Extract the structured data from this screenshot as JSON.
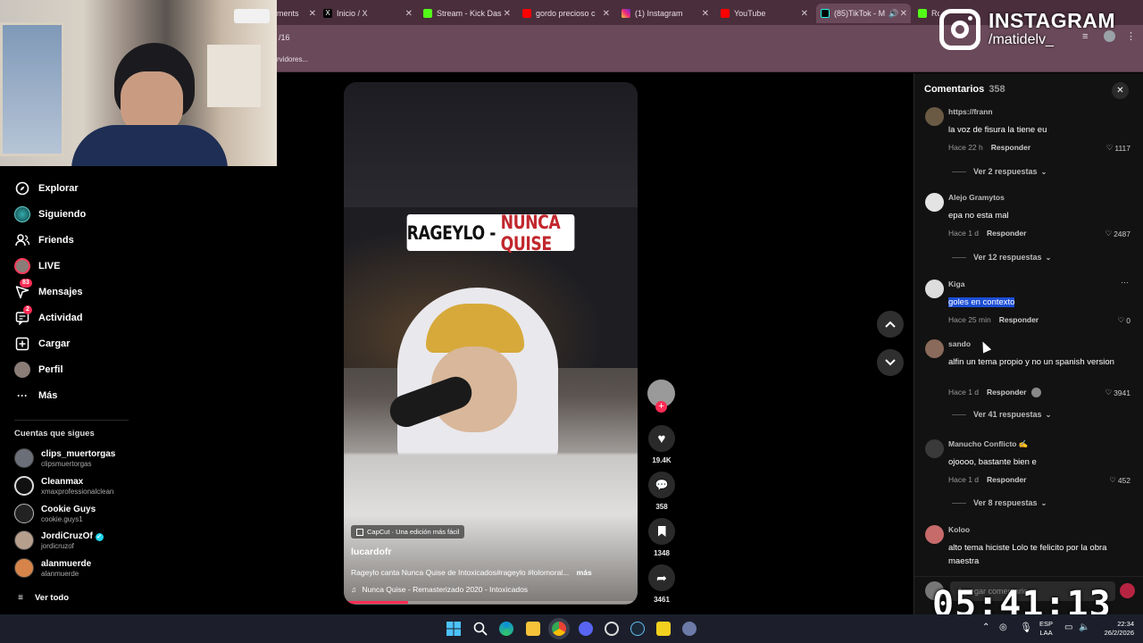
{
  "browser": {
    "tabs": [
      {
        "label": "ments",
        "color": "#2b6fd6"
      },
      {
        "label": "Inicio / X",
        "color": "#000000"
      },
      {
        "label": "Stream - Kick Das",
        "color": "#53fc18"
      },
      {
        "label": "gordo precioso c",
        "color": "#ff0000"
      },
      {
        "label": "(1) Instagram",
        "color": "#e1306c"
      },
      {
        "label": "YouTube",
        "color": "#ff0000"
      },
      {
        "label": "(85)TikTok - M",
        "color": "#000000"
      },
      {
        "label": "Ro",
        "color": "#53fc18"
      }
    ],
    "url_fragment": "/16",
    "bookmark_text": "rvidores..."
  },
  "overlay": {
    "instagram_title": "INSTAGRAM",
    "instagram_handle": "/matidelv_",
    "timer": "05:41:13"
  },
  "nav": {
    "items": [
      {
        "label": "Explorar",
        "icon": "compass-icon"
      },
      {
        "label": "Siguiendo",
        "icon": "following-icon"
      },
      {
        "label": "Friends",
        "icon": "friends-icon"
      },
      {
        "label": "LIVE",
        "icon": "live-icon"
      },
      {
        "label": "Mensajes",
        "icon": "messages-icon",
        "badge": "83"
      },
      {
        "label": "Actividad",
        "icon": "activity-icon",
        "badge": "2"
      },
      {
        "label": "Cargar",
        "icon": "upload-icon"
      },
      {
        "label": "Perfil",
        "icon": "profile-icon"
      },
      {
        "label": "Más",
        "icon": "more-icon"
      }
    ],
    "following_header": "Cuentas que sigues",
    "following": [
      {
        "name": "clips_muertorgas",
        "handle": "clipsmuertorgas"
      },
      {
        "name": "Cleanmax",
        "handle": "xmaxprofessionalclean"
      },
      {
        "name": "Cookie Guys",
        "handle": "cookie.guys1"
      },
      {
        "name": "JordiCruzOf",
        "handle": "jordicruzof",
        "verified": true
      },
      {
        "name": "alanmuerde",
        "handle": "alanmuerde"
      }
    ],
    "see_all": "Ver todo"
  },
  "video": {
    "title_white": "RAGEYLO - ",
    "title_red": "NUNCA QUISE",
    "capcut_tag": "CapCut · Una edición más fácil",
    "author": "lucardofr",
    "description": "Rageylo canta Nunca Quise de Intoxicados#rageylo #lolomoral...",
    "more": "más",
    "music": "Nunca Quise - Remasterizado 2020 - Intoxicados",
    "progress": 0.22,
    "likes": "19.4K",
    "comments": "358",
    "saves": "1348",
    "shares": "3461"
  },
  "comments_panel": {
    "title": "Comentarios",
    "count": "358",
    "reply_label": "Responder",
    "input_placeholder": "Agregar comentario...",
    "items": [
      {
        "user": "https://frann",
        "text": "la voz de fisura la tiene eu",
        "time": "Hace 22 h",
        "likes": "1117",
        "replies": "Ver 2 respuestas"
      },
      {
        "user": "Alejo Gramytos",
        "text": "epa no esta mal",
        "time": "Hace 1 d",
        "likes": "2487",
        "replies": "Ver 12 respuestas"
      },
      {
        "user": "Kiga",
        "text": "goles en contexto",
        "time": "Hace 25 min",
        "likes": "0",
        "replies": ""
      },
      {
        "user": "sando",
        "text": "alfin un tema propio y no un spanish version",
        "time": "Hace 1 d",
        "likes": "3941",
        "replies": "Ver 41 respuestas"
      },
      {
        "user": "Manucho Conflicto ✍️",
        "text": "ojoooo, bastante bien e",
        "time": "Hace 1 d",
        "likes": "452",
        "replies": "Ver 8 respuestas"
      },
      {
        "user": "Koloo",
        "text": "alto tema hiciste Lolo te felicito por la obra maestra",
        "time": "",
        "likes": "",
        "replies": ""
      }
    ]
  },
  "taskbar": {
    "lang_top": "ESP",
    "lang_bottom": "LAA",
    "time": "22:34",
    "date": "26/2/2026"
  }
}
